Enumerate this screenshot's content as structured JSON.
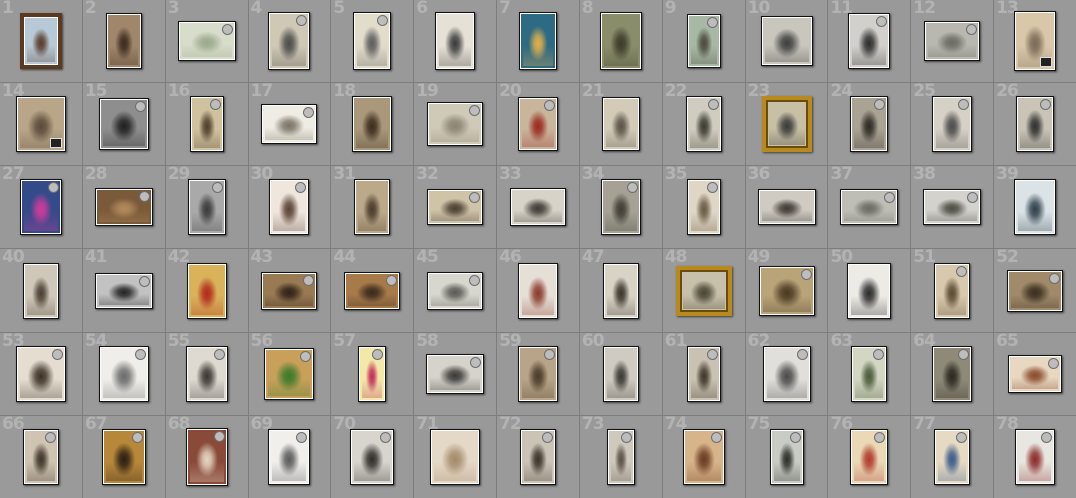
{
  "grid": {
    "columns": 13,
    "rows": 6
  },
  "palette": {
    "background": "#8c8c8c",
    "cell": "#9a9a9a",
    "cell_number": "#b3b3b3",
    "frame_gold": "#b88a1e"
  },
  "thumbnails": [
    {
      "num": "1",
      "w": 42,
      "h": 56,
      "tone": "#b7c9d6",
      "ink": "#5a3a2a",
      "frame": "framed-dark",
      "badge": false
    },
    {
      "num": "2",
      "w": 36,
      "h": 56,
      "tone": "#a0866a",
      "ink": "#3b2a1e",
      "frame": "",
      "badge": false
    },
    {
      "num": "3",
      "w": 58,
      "h": 40,
      "tone": "#d8dccb",
      "ink": "#9aa88c",
      "frame": "",
      "badge": true
    },
    {
      "num": "4",
      "w": 42,
      "h": 58,
      "tone": "#cfc8b4",
      "ink": "#4a4a4a",
      "frame": "",
      "badge": true
    },
    {
      "num": "5",
      "w": 38,
      "h": 58,
      "tone": "#e2dccb",
      "ink": "#5c5c5c",
      "frame": "",
      "badge": true
    },
    {
      "num": "6",
      "w": 40,
      "h": 58,
      "tone": "#e6e1d6",
      "ink": "#3a3a3a",
      "frame": "",
      "badge": false
    },
    {
      "num": "7",
      "w": 38,
      "h": 58,
      "tone": "#2e6a84",
      "ink": "#e0b04a",
      "frame": "",
      "badge": false
    },
    {
      "num": "8",
      "w": 42,
      "h": 58,
      "tone": "#8a8d6a",
      "ink": "#3b3a2a",
      "frame": "",
      "badge": false
    },
    {
      "num": "9",
      "w": 34,
      "h": 54,
      "tone": "#a7b9a4",
      "ink": "#4b4a3d",
      "frame": "",
      "badge": true
    },
    {
      "num": "10",
      "w": 52,
      "h": 50,
      "tone": "#c9c6bd",
      "ink": "#3e3e3e",
      "frame": "",
      "badge": false
    },
    {
      "num": "11",
      "w": 42,
      "h": 56,
      "tone": "#d2d0cc",
      "ink": "#2c2c2c",
      "frame": "",
      "badge": true
    },
    {
      "num": "12",
      "w": 56,
      "h": 40,
      "tone": "#b8b8b0",
      "ink": "#6a6a62",
      "frame": "",
      "badge": true
    },
    {
      "num": "13",
      "w": 42,
      "h": 60,
      "tone": "#d8c7a8",
      "ink": "#7a6a56",
      "frame": "",
      "badge": false
    },
    {
      "num": "14",
      "w": 50,
      "h": 56,
      "tone": "#b9a587",
      "ink": "#5a4a3a",
      "frame": "",
      "badge": false
    },
    {
      "num": "15",
      "w": 50,
      "h": 52,
      "tone": "#8e8e8e",
      "ink": "#202020",
      "frame": "",
      "badge": true
    },
    {
      "num": "16",
      "w": 34,
      "h": 56,
      "tone": "#d0c29e",
      "ink": "#4f3f2b",
      "frame": "",
      "badge": true
    },
    {
      "num": "17",
      "w": 56,
      "h": 40,
      "tone": "#efece4",
      "ink": "#7a7466",
      "frame": "",
      "badge": true
    },
    {
      "num": "18",
      "w": 40,
      "h": 56,
      "tone": "#a9987a",
      "ink": "#3a2b1c",
      "frame": "",
      "badge": false
    },
    {
      "num": "19",
      "w": 56,
      "h": 44,
      "tone": "#cfc9b7",
      "ink": "#8a846f",
      "frame": "",
      "badge": true
    },
    {
      "num": "20",
      "w": 40,
      "h": 54,
      "tone": "#c9b49c",
      "ink": "#9a2a1c",
      "frame": "",
      "badge": true
    },
    {
      "num": "21",
      "w": 38,
      "h": 54,
      "tone": "#d3cbb8",
      "ink": "#5a5246",
      "frame": "",
      "badge": false
    },
    {
      "num": "22",
      "w": 36,
      "h": 56,
      "tone": "#d0ccbf",
      "ink": "#3a3a32",
      "frame": "",
      "badge": true
    },
    {
      "num": "23",
      "w": 50,
      "h": 56,
      "tone": "#c8c0a4",
      "ink": "#3a3a3a",
      "frame": "framed",
      "badge": false
    },
    {
      "num": "24",
      "w": 38,
      "h": 56,
      "tone": "#a9a394",
      "ink": "#2e2a22",
      "frame": "",
      "badge": true
    },
    {
      "num": "25",
      "w": 40,
      "h": 56,
      "tone": "#d6d1c6",
      "ink": "#4a4a4a",
      "frame": "",
      "badge": true
    },
    {
      "num": "26",
      "w": 38,
      "h": 56,
      "tone": "#c9c4b6",
      "ink": "#2f2f2f",
      "frame": "",
      "badge": true
    },
    {
      "num": "27",
      "w": 42,
      "h": 56,
      "tone": "#344b8a",
      "ink": "#d23a9a",
      "frame": "",
      "badge": true
    },
    {
      "num": "28",
      "w": 58,
      "h": 38,
      "tone": "#7b5a3a",
      "ink": "#b28a5c",
      "frame": "",
      "badge": true
    },
    {
      "num": "29",
      "w": 38,
      "h": 56,
      "tone": "#a9a9a9",
      "ink": "#3a3a3a",
      "frame": "",
      "badge": true
    },
    {
      "num": "30",
      "w": 40,
      "h": 56,
      "tone": "#efe6de",
      "ink": "#5a4032",
      "frame": "",
      "badge": true
    },
    {
      "num": "31",
      "w": 36,
      "h": 56,
      "tone": "#bba98a",
      "ink": "#4a3a2a",
      "frame": "",
      "badge": false
    },
    {
      "num": "32",
      "w": 56,
      "h": 36,
      "tone": "#cfc3a8",
      "ink": "#4a3f30",
      "frame": "",
      "badge": true
    },
    {
      "num": "33",
      "w": 56,
      "h": 38,
      "tone": "#d7d3c9",
      "ink": "#3d3a33",
      "frame": "",
      "badge": false
    },
    {
      "num": "34",
      "w": 40,
      "h": 56,
      "tone": "#a5a295",
      "ink": "#3e3c33",
      "frame": "",
      "badge": true
    },
    {
      "num": "35",
      "w": 34,
      "h": 56,
      "tone": "#dfd6c6",
      "ink": "#6a5a44",
      "frame": "",
      "badge": true
    },
    {
      "num": "36",
      "w": 58,
      "h": 36,
      "tone": "#cfcbc2",
      "ink": "#3d3a34",
      "frame": "",
      "badge": false
    },
    {
      "num": "37",
      "w": 58,
      "h": 36,
      "tone": "#bebdb6",
      "ink": "#6c6b63",
      "frame": "",
      "badge": true
    },
    {
      "num": "38",
      "w": 58,
      "h": 36,
      "tone": "#d3d2cc",
      "ink": "#4c4b44",
      "frame": "",
      "badge": true
    },
    {
      "num": "39",
      "w": 42,
      "h": 56,
      "tone": "#dbe3e6",
      "ink": "#2d3f4a",
      "frame": "",
      "badge": false
    },
    {
      "num": "40",
      "w": 36,
      "h": 56,
      "tone": "#cfc7b8",
      "ink": "#4a3e32",
      "frame": "",
      "badge": false
    },
    {
      "num": "41",
      "w": 58,
      "h": 36,
      "tone": "#c2c2c2",
      "ink": "#232323",
      "frame": "",
      "badge": true
    },
    {
      "num": "42",
      "w": 40,
      "h": 56,
      "tone": "#d9b25a",
      "ink": "#b02a1c",
      "frame": "",
      "badge": false
    },
    {
      "num": "43",
      "w": 56,
      "h": 38,
      "tone": "#9a7a52",
      "ink": "#2e2218",
      "frame": "",
      "badge": true
    },
    {
      "num": "44",
      "w": 56,
      "h": 38,
      "tone": "#a77a4a",
      "ink": "#3a2a1e",
      "frame": "",
      "badge": true
    },
    {
      "num": "45",
      "w": 56,
      "h": 38,
      "tone": "#d7d6cf",
      "ink": "#5a5a54",
      "frame": "",
      "badge": true
    },
    {
      "num": "46",
      "w": 40,
      "h": 56,
      "tone": "#e6dfd6",
      "ink": "#8a3a2a",
      "frame": "",
      "badge": false
    },
    {
      "num": "47",
      "w": 36,
      "h": 56,
      "tone": "#d9d3c6",
      "ink": "#3a3328",
      "frame": "",
      "badge": false
    },
    {
      "num": "48",
      "w": 56,
      "h": 50,
      "tone": "#c7c0aa",
      "ink": "#4a4434",
      "frame": "framed",
      "badge": false
    },
    {
      "num": "49",
      "w": 56,
      "h": 50,
      "tone": "#b9a47a",
      "ink": "#4a3820",
      "frame": "",
      "badge": true
    },
    {
      "num": "50",
      "w": 44,
      "h": 56,
      "tone": "#ecebe6",
      "ink": "#2a2a2a",
      "frame": "",
      "badge": false
    },
    {
      "num": "51",
      "w": 36,
      "h": 56,
      "tone": "#d8c9ae",
      "ink": "#5a4a32",
      "frame": "",
      "badge": true
    },
    {
      "num": "52",
      "w": 56,
      "h": 42,
      "tone": "#a08a6a",
      "ink": "#3a2e1e",
      "frame": "",
      "badge": true
    },
    {
      "num": "53",
      "w": 50,
      "h": 56,
      "tone": "#e4ddd0",
      "ink": "#3a3024",
      "frame": "",
      "badge": true
    },
    {
      "num": "54",
      "w": 50,
      "h": 56,
      "tone": "#efeeea",
      "ink": "#6a6a6a",
      "frame": "",
      "badge": true
    },
    {
      "num": "55",
      "w": 42,
      "h": 56,
      "tone": "#dedad2",
      "ink": "#3a3630",
      "frame": "",
      "badge": true
    },
    {
      "num": "56",
      "w": 50,
      "h": 52,
      "tone": "#c9a05a",
      "ink": "#3a7a2a",
      "frame": "",
      "badge": true
    },
    {
      "num": "57",
      "w": 28,
      "h": 56,
      "tone": "#f2e8a8",
      "ink": "#c42a5a",
      "frame": "",
      "badge": true
    },
    {
      "num": "58",
      "w": 58,
      "h": 40,
      "tone": "#d6d3cc",
      "ink": "#3a3834",
      "frame": "",
      "badge": true
    },
    {
      "num": "59",
      "w": 40,
      "h": 56,
      "tone": "#b8a488",
      "ink": "#4a3a28",
      "frame": "",
      "badge": true
    },
    {
      "num": "60",
      "w": 36,
      "h": 56,
      "tone": "#cfcbc2",
      "ink": "#3a3832",
      "frame": "",
      "badge": false
    },
    {
      "num": "61",
      "w": 34,
      "h": 56,
      "tone": "#c9c2b2",
      "ink": "#3e362a",
      "frame": "",
      "badge": true
    },
    {
      "num": "62",
      "w": 48,
      "h": 56,
      "tone": "#e0dfdb",
      "ink": "#4a4a4a",
      "frame": "",
      "badge": true
    },
    {
      "num": "63",
      "w": 36,
      "h": 56,
      "tone": "#d2d6c2",
      "ink": "#4a5a3a",
      "frame": "",
      "badge": true
    },
    {
      "num": "64",
      "w": 40,
      "h": 56,
      "tone": "#8f8a78",
      "ink": "#2a2820",
      "frame": "",
      "badge": true
    },
    {
      "num": "65",
      "w": 54,
      "h": 38,
      "tone": "#e8d8c2",
      "ink": "#8a4a2a",
      "frame": "",
      "badge": true
    },
    {
      "num": "66",
      "w": 36,
      "h": 56,
      "tone": "#cfc4b2",
      "ink": "#3e3428",
      "frame": "",
      "badge": true
    },
    {
      "num": "67",
      "w": 44,
      "h": 56,
      "tone": "#b8883a",
      "ink": "#2a1e12",
      "frame": "",
      "badge": true
    },
    {
      "num": "68",
      "w": 42,
      "h": 58,
      "tone": "#8a4a3a",
      "ink": "#e6d6c2",
      "frame": "",
      "badge": true
    },
    {
      "num": "69",
      "w": 42,
      "h": 56,
      "tone": "#f0efec",
      "ink": "#5a5a5a",
      "frame": "",
      "badge": true
    },
    {
      "num": "70",
      "w": 44,
      "h": 56,
      "tone": "#d8d5cf",
      "ink": "#2e2a26",
      "frame": "",
      "badge": true
    },
    {
      "num": "71",
      "w": 50,
      "h": 56,
      "tone": "#e4d8c6",
      "ink": "#a48a6a",
      "frame": "",
      "badge": false
    },
    {
      "num": "72",
      "w": 36,
      "h": 56,
      "tone": "#cbc4b6",
      "ink": "#3a3228",
      "frame": "",
      "badge": true
    },
    {
      "num": "73",
      "w": 28,
      "h": 56,
      "tone": "#cfc8bc",
      "ink": "#5a5046",
      "frame": "",
      "badge": true
    },
    {
      "num": "74",
      "w": 42,
      "h": 56,
      "tone": "#d8b48a",
      "ink": "#6a3a22",
      "frame": "",
      "badge": true
    },
    {
      "num": "75",
      "w": 34,
      "h": 56,
      "tone": "#c9ccc4",
      "ink": "#2a2e26",
      "frame": "",
      "badge": true
    },
    {
      "num": "76",
      "w": 38,
      "h": 56,
      "tone": "#ead8b6",
      "ink": "#b03a2a",
      "frame": "",
      "badge": true
    },
    {
      "num": "77",
      "w": 36,
      "h": 56,
      "tone": "#e6dac2",
      "ink": "#3a5a8a",
      "frame": "",
      "badge": true
    },
    {
      "num": "78",
      "w": 40,
      "h": 56,
      "tone": "#e8e6e0",
      "ink": "#8a2a2a",
      "frame": "",
      "badge": true
    }
  ]
}
